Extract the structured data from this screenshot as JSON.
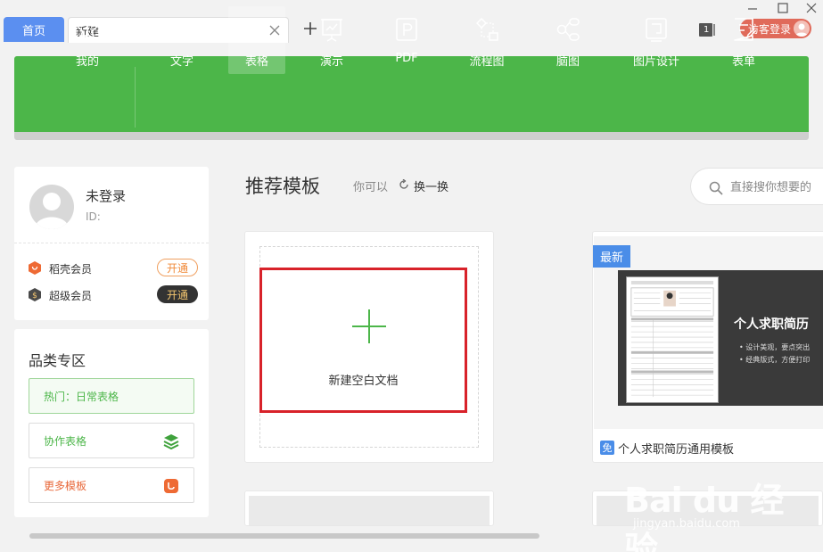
{
  "tabs": {
    "home": "首页",
    "current": "新建"
  },
  "window": {
    "count_badge": "1",
    "login_label": "访客登录"
  },
  "toolbar": {
    "items": [
      {
        "label": "我的",
        "icon": "star-icon"
      },
      {
        "label": "文字",
        "icon": "document-icon"
      },
      {
        "label": "表格",
        "icon": "table-icon",
        "active": true
      },
      {
        "label": "演示",
        "icon": "presentation-icon"
      },
      {
        "label": "PDF",
        "icon": "pdf-icon"
      },
      {
        "label": "流程图",
        "icon": "flowchart-icon"
      },
      {
        "label": "脑图",
        "icon": "mindmap-icon"
      },
      {
        "label": "图片设计",
        "icon": "image-design-icon"
      },
      {
        "label": "表单",
        "icon": "form-icon"
      }
    ],
    "colors": {
      "background": "#4cb649"
    }
  },
  "user": {
    "name": "未登录",
    "id_label": "ID:",
    "members": [
      {
        "name": "稻壳会员",
        "action": "开通"
      },
      {
        "name": "超级会员",
        "action": "开通"
      }
    ]
  },
  "categories": {
    "title": "品类专区",
    "items": [
      {
        "label": "热门：日常表格"
      },
      {
        "label": "协作表格"
      },
      {
        "label": "更多模板"
      }
    ]
  },
  "recommend": {
    "title": "推荐模板",
    "hint": "你可以",
    "refresh": "换一换"
  },
  "search": {
    "placeholder": "直接搜你想要的"
  },
  "blank": {
    "label": "新建空白文档"
  },
  "template": {
    "tag": "最新",
    "free_badge": "免",
    "name": "个人求职简历通用模板",
    "thumb_heading": "个人求职简历",
    "thumb_bullets": [
      "设计美观，要点突出",
      "经典版式，方便打印"
    ]
  },
  "watermark": {
    "brand": "Bai du 经验",
    "url": "jingyan.baidu.com"
  }
}
